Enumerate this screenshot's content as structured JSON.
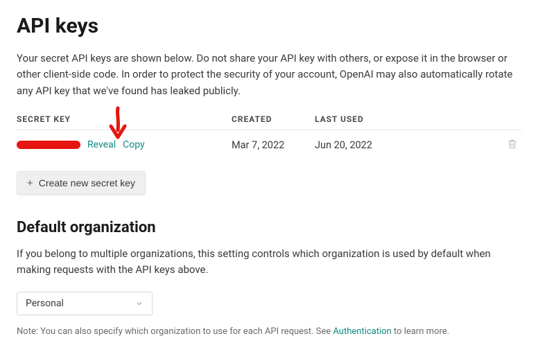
{
  "title": "API keys",
  "intro": "Your secret API keys are shown below. Do not share your API key with others, or expose it in the browser or other client-side code. In order to protect the security of your account, OpenAI may also automatically rotate any API key that we've found has leaked publicly.",
  "table": {
    "headers": {
      "secret": "SECRET KEY",
      "created": "CREATED",
      "lastused": "LAST USED"
    },
    "row": {
      "reveal": "Reveal",
      "copy": "Copy",
      "created": "Mar 7, 2022",
      "lastused": "Jun 20, 2022"
    }
  },
  "create_button": "Create new secret key",
  "default_org": {
    "title": "Default organization",
    "text": "If you belong to multiple organizations, this setting controls which organization is used by default when making requests with the API keys above.",
    "selected": "Personal",
    "note_prefix": "Note: You can also specify which organization to use for each API request. See ",
    "note_link": "Authentication",
    "note_suffix": " to learn more."
  },
  "colors": {
    "link": "#0d8a7f",
    "annotation": "#e6150f"
  }
}
